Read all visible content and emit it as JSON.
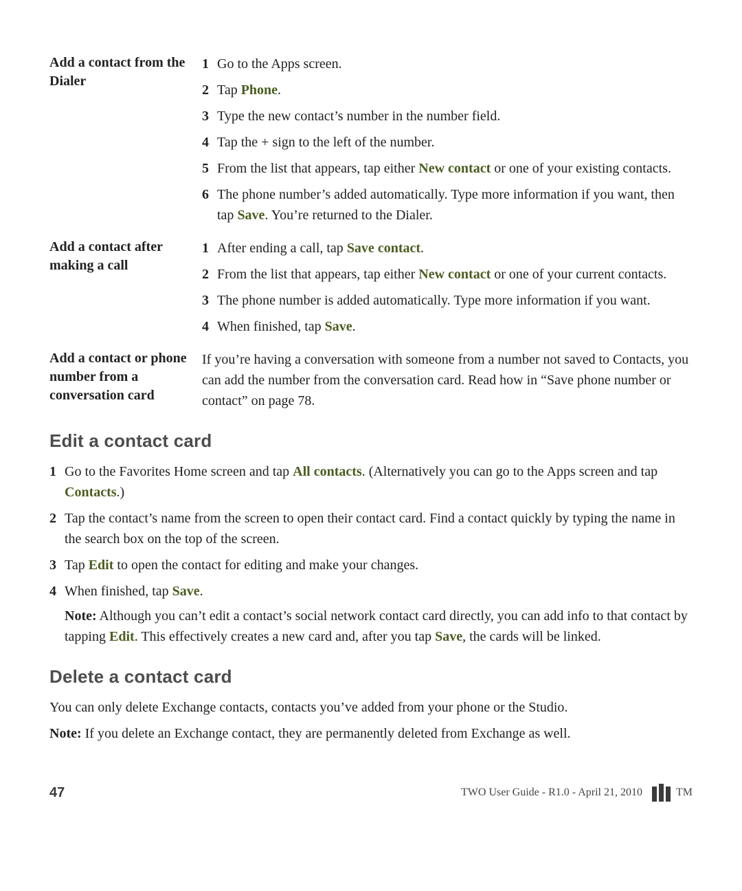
{
  "sections": {
    "dialer": {
      "title": "Add a contact from the Dialer",
      "steps": [
        {
          "pre": "Go to the Apps screen."
        },
        {
          "pre": "Tap ",
          "bold": "Phone",
          "post": "."
        },
        {
          "pre": "Type the new contact’s number in the number field."
        },
        {
          "pre": "Tap the + sign to the left of the number."
        },
        {
          "pre": "From the list that appears, tap either ",
          "bold": "New contact",
          "post": " or one of your existing contacts."
        },
        {
          "pre": "The phone number’s added automatically. Type more information if you want, then tap ",
          "bold": "Save",
          "post": ". You’re returned to the Dialer."
        }
      ]
    },
    "aftercall": {
      "title": "Add a contact after making a call",
      "steps": [
        {
          "pre": "After ending a call, tap ",
          "bold": "Save contact",
          "post": "."
        },
        {
          "pre": "From the list that appears, tap either ",
          "bold": "New contact",
          "post": " or one of your current contacts."
        },
        {
          "pre": "The phone number is added automatically. Type more information if you want."
        },
        {
          "pre": "When finished, tap ",
          "bold": "Save",
          "post": "."
        }
      ]
    },
    "convo": {
      "title": "Add a contact or phone number from a conversation card",
      "body": "If you’re having a conversation with someone from a number not saved to Contacts, you can add the number from the conversation card. Read how in “Save phone number or contact” on page 78."
    }
  },
  "edit": {
    "heading": "Edit a contact card",
    "steps": [
      {
        "segments": [
          {
            "t": "Go to the Favorites Home screen and tap "
          },
          {
            "t": "All contacts",
            "b": true
          },
          {
            "t": ". (Alternatively you can go to the Apps screen and tap "
          },
          {
            "t": "Contacts",
            "b": true
          },
          {
            "t": ".)"
          }
        ]
      },
      {
        "segments": [
          {
            "t": "Tap the contact’s name from the screen to open their contact card. Find a contact quickly by typing the name in the search box on the top of the screen."
          }
        ]
      },
      {
        "segments": [
          {
            "t": "Tap "
          },
          {
            "t": "Edit",
            "b": true
          },
          {
            "t": " to open the contact for editing and make your changes."
          }
        ]
      },
      {
        "segments": [
          {
            "t": "When finished, tap "
          },
          {
            "t": "Save",
            "b": true
          },
          {
            "t": "."
          }
        ],
        "note_segments": [
          {
            "t": "Note:",
            "nb": true
          },
          {
            "t": " Although you can’t edit a contact’s social network contact card directly, you can add info to that contact by tapping "
          },
          {
            "t": "Edit",
            "b": true
          },
          {
            "t": ". This effectively creates a new card and, after you tap "
          },
          {
            "t": "Save",
            "b": true
          },
          {
            "t": ", the cards will be linked."
          }
        ]
      }
    ]
  },
  "delete": {
    "heading": "Delete a contact card",
    "para": "You can only delete Exchange contacts, contacts you’ve added from your phone or the Studio.",
    "note_label": "Note:",
    "note_text": " If you delete an Exchange contact, they are permanently deleted from Exchange as well."
  },
  "footer": {
    "page": "47",
    "doc": "TWO User Guide - R1.0 - April 21, 2010",
    "tm": "TM"
  }
}
